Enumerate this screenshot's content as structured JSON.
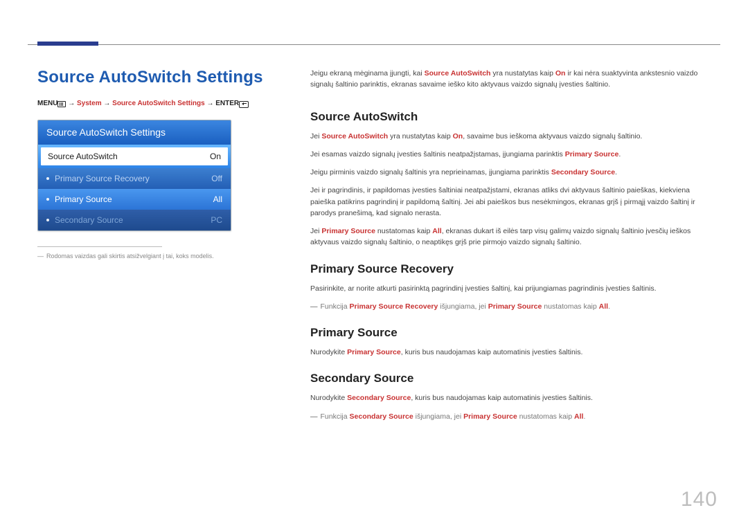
{
  "page_number": "140",
  "title": "Source AutoSwitch Settings",
  "breadcrumb": {
    "menu": "MENU",
    "arrow1": " → ",
    "system": "System",
    "arrow2": " → ",
    "sass": "Source AutoSwitch Settings",
    "arrow3": " → ",
    "enter": "ENTER"
  },
  "panel": {
    "title": "Source AutoSwitch Settings",
    "rows": [
      {
        "label": "Source AutoSwitch",
        "value": "On"
      },
      {
        "label": "Primary Source Recovery",
        "value": "Off"
      },
      {
        "label": "Primary Source",
        "value": "All"
      },
      {
        "label": "Secondary Source",
        "value": "PC"
      }
    ]
  },
  "panel_note": "Rodomas vaizdas gali skirtis atsižvelgiant į tai, koks modelis.",
  "intro": {
    "p1a": "Jeigu ekraną mėginama įjungti, kai ",
    "p1b": "Source AutoSwitch",
    "p1c": " yra nustatytas kaip ",
    "p1d": "On",
    "p1e": " ir kai nėra suaktyvinta ankstesnio vaizdo signalų šaltinio parinktis, ekranas savaime ieško kito aktyvaus vaizdo signalų įvesties šaltinio."
  },
  "sec1": {
    "heading": "Source AutoSwitch",
    "p1a": "Jei ",
    "p1b": "Source AutoSwitch",
    "p1c": " yra nustatytas kaip ",
    "p1d": "On",
    "p1e": ", savaime bus ieškoma aktyvaus vaizdo signalų šaltinio.",
    "p2a": "Jei esamas vaizdo signalų įvesties šaltinis neatpažįstamas, įjungiama parinktis ",
    "p2b": "Primary Source",
    "p2c": ".",
    "p3a": "Jeigu pirminis vaizdo signalų šaltinis yra neprieinamas, įjungiama parinktis ",
    "p3b": "Secondary Source",
    "p3c": ".",
    "p4": "Jei ir pagrindinis, ir papildomas įvesties šaltiniai neatpažįstami, ekranas atliks dvi aktyvaus šaltinio paieškas, kiekviena paieška patikrins pagrindinį ir papildomą šaltinį. Jei abi paieškos bus nesėkmingos, ekranas grįš į pirmąjį vaizdo šaltinį ir parodys pranešimą, kad signalo nerasta.",
    "p5a": "Jei ",
    "p5b": "Primary Source",
    "p5c": " nustatomas kaip ",
    "p5d": "All",
    "p5e": ", ekranas dukart iš eilės tarp visų galimų vaizdo signalų šaltinio įvesčių ieškos aktyvaus vaizdo signalų šaltinio, o neaptikęs grįš prie pirmojo vaizdo signalų šaltinio."
  },
  "sec2": {
    "heading": "Primary Source Recovery",
    "p1": "Pasirinkite, ar norite atkurti pasirinktą pagrindinį įvesties šaltinį, kai prijungiamas pagrindinis įvesties šaltinis.",
    "n1a": "Funkcija ",
    "n1b": "Primary Source Recovery",
    "n1c": " išjungiama, jei ",
    "n1d": "Primary Source",
    "n1e": " nustatomas kaip ",
    "n1f": "All",
    "n1g": "."
  },
  "sec3": {
    "heading": "Primary Source",
    "p1a": "Nurodykite ",
    "p1b": "Primary Source",
    "p1c": ", kuris bus naudojamas kaip automatinis įvesties šaltinis."
  },
  "sec4": {
    "heading": "Secondary Source",
    "p1a": "Nurodykite ",
    "p1b": "Secondary Source",
    "p1c": ", kuris bus naudojamas kaip automatinis įvesties šaltinis.",
    "n1a": "Funkcija ",
    "n1b": "Secondary Source",
    "n1c": " išjungiama, jei ",
    "n1d": "Primary Source",
    "n1e": " nustatomas kaip ",
    "n1f": "All",
    "n1g": "."
  }
}
